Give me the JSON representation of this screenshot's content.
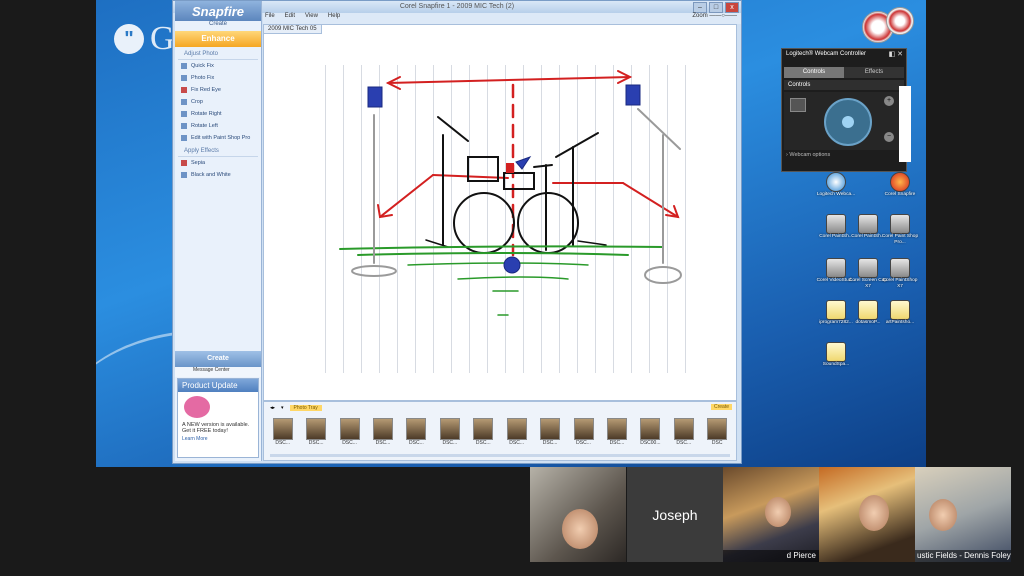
{
  "hangout": {
    "brand": "Google+",
    "participants": [
      {
        "label": ""
      },
      {
        "label": "Joseph"
      },
      {
        "label": "d Pierce"
      },
      {
        "label": ""
      },
      {
        "label": "ustic Fields - Dennis Foley"
      }
    ]
  },
  "app": {
    "title": "Corel Snapfire 1 - 2009 MIC Tech (2)",
    "logo": "Snapfire",
    "create_top": "Create",
    "enhance": "Enhance",
    "menu": [
      "File",
      "Edit",
      "View",
      "Help"
    ],
    "zoom_label": "Zoom",
    "doc_tab": "2009 MIC Tech 05",
    "sections": {
      "adjust_title": "Adjust Photo",
      "adjust": [
        {
          "label": "Quick Fix",
          "icon": "quick-fix-icon"
        },
        {
          "label": "Photo Fix",
          "icon": "photo-fix-icon"
        },
        {
          "label": "Fix Red Eye",
          "icon": "red-eye-icon"
        },
        {
          "label": "Crop",
          "icon": "crop-icon"
        },
        {
          "label": "Rotate Right",
          "icon": "rotate-right-icon"
        },
        {
          "label": "Rotate Left",
          "icon": "rotate-left-icon"
        },
        {
          "label": "Edit with Paint Shop Pro",
          "icon": "paint-shop-icon"
        }
      ],
      "effects_title": "Apply Effects",
      "effects": [
        {
          "label": "Sepia",
          "icon": "sepia-icon"
        },
        {
          "label": "Black and White",
          "icon": "bw-icon"
        }
      ]
    },
    "create_btn": "Create",
    "message_center": "Message Center",
    "product_update": {
      "title": "Product Update",
      "text": "A NEW version is available. Get it FREE today!",
      "more": "Learn More"
    },
    "tray": {
      "tab": "Photo Tray",
      "flag": "Create",
      "thumbs": [
        "DSC...",
        "DSC...",
        "DSC...",
        "DSC...",
        "DSC...",
        "DSC...",
        "DSC...",
        "DSC...",
        "DSC...",
        "DSC...",
        "DSC...",
        "DSC00...",
        "DSC...",
        "DSC"
      ]
    }
  },
  "webcam": {
    "title": "Logitech® Webcam Controller",
    "tabs": [
      "Controls",
      "Effects"
    ],
    "section": "Controls",
    "options": "Webcam options"
  },
  "desktop_icons": [
    {
      "label": "Logitech Webca...",
      "kind": "cam"
    },
    {
      "label": "Corel Snapfire",
      "kind": "red"
    },
    {
      "label": "Corel PaintSh...",
      "kind": "gray"
    },
    {
      "label": "Corel PaintSh...",
      "kind": "gray"
    },
    {
      "label": "Corel Paint Shop Pro...",
      "kind": "gray"
    },
    {
      "label": "Corel VideoStud...",
      "kind": "gray"
    },
    {
      "label": "Corel Screen Cap X7",
      "kind": "gray"
    },
    {
      "label": "Corel PaintShop X7",
      "kind": "gray"
    },
    {
      "label": "iprogram7282...",
      "kind": "doc"
    },
    {
      "label": "dotasmoP...",
      "kind": "doc"
    },
    {
      "label": "artPaintsho...",
      "kind": "doc"
    },
    {
      "label": "SoundSpa...",
      "kind": "doc"
    }
  ]
}
